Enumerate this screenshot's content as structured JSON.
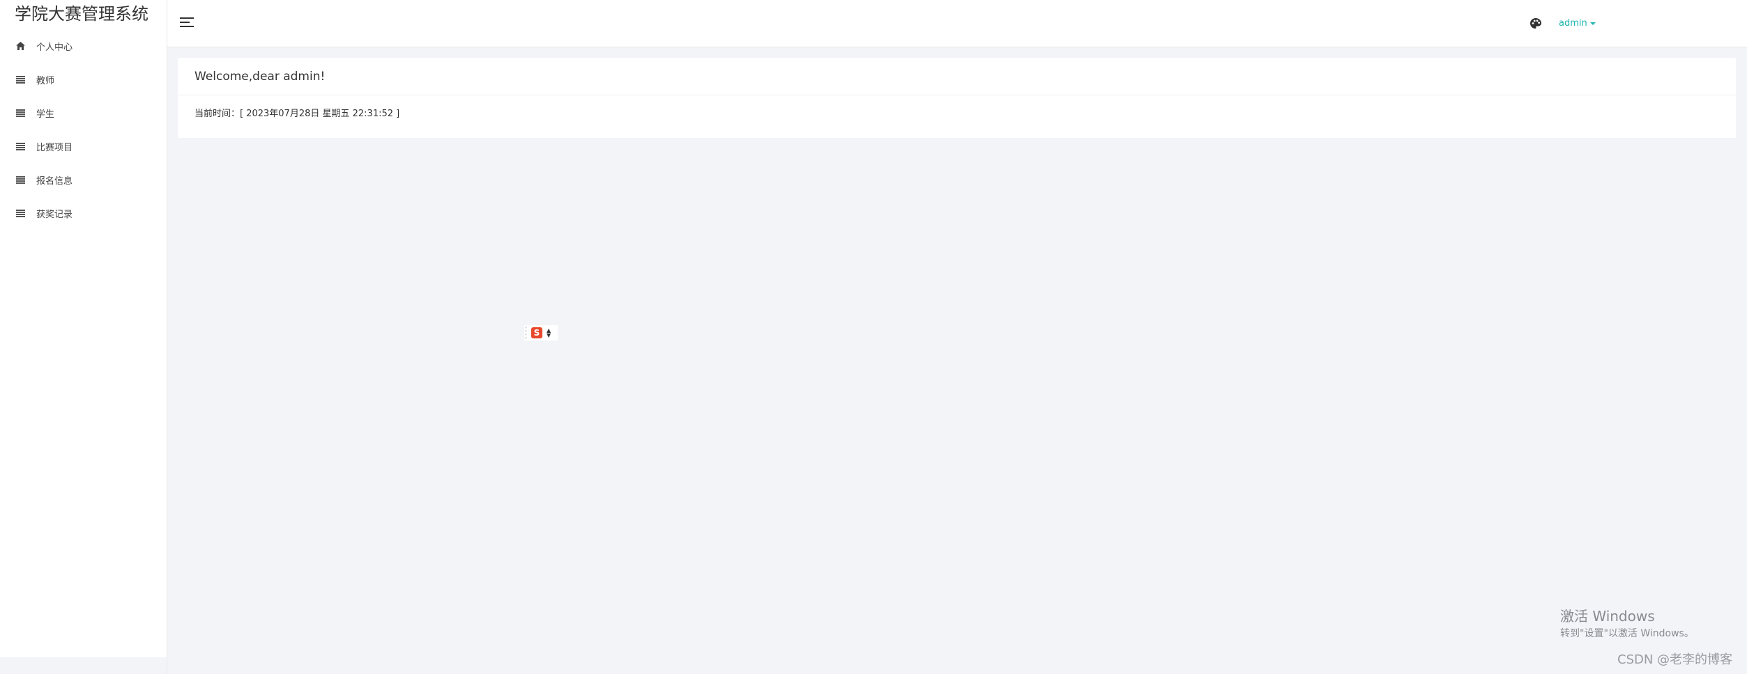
{
  "app": {
    "title": "学院大赛管理系统"
  },
  "sidebar": {
    "items": [
      {
        "label": "个人中心",
        "icon": "home-icon"
      },
      {
        "label": "教师",
        "icon": "list-icon"
      },
      {
        "label": "学生",
        "icon": "list-icon"
      },
      {
        "label": "比赛项目",
        "icon": "list-icon"
      },
      {
        "label": "报名信息",
        "icon": "list-icon"
      },
      {
        "label": "获奖记录",
        "icon": "list-icon"
      }
    ]
  },
  "topbar": {
    "menu_icon": "hamburger-icon",
    "theme_icon": "palette-icon",
    "user": "admin",
    "accent_color": "#1fb5ad"
  },
  "main": {
    "welcome": "Welcome,dear admin!",
    "current_time": "当前时间：[ 2023年07月28日 星期五 22:31:52 ]"
  },
  "ime": {
    "icon": "sogou-ime-icon",
    "glyph": "S"
  },
  "overlay": {
    "windows_activate_title": "激活 Windows",
    "windows_activate_subtitle": "转到\"设置\"以激活 Windows。",
    "watermark": "CSDN @老李的博客"
  }
}
